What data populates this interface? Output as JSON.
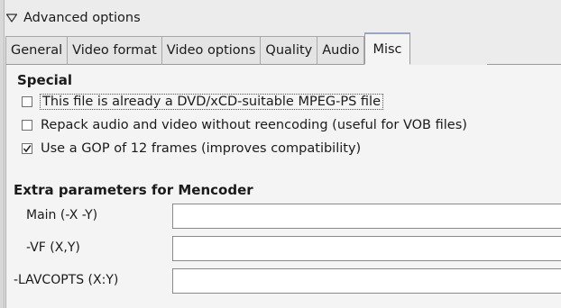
{
  "expander": {
    "label": "Advanced options",
    "expanded": true
  },
  "tabs": [
    {
      "label": "General",
      "active": false
    },
    {
      "label": "Video format",
      "active": false
    },
    {
      "label": "Video options",
      "active": false
    },
    {
      "label": "Quality",
      "active": false
    },
    {
      "label": "Audio",
      "active": false
    },
    {
      "label": "Misc",
      "active": true
    }
  ],
  "special": {
    "heading": "Special",
    "options": [
      {
        "label": "This file is already a DVD/xCD-suitable MPEG-PS file",
        "checked": false
      },
      {
        "label": "Repack audio and video without reencoding (useful for VOB files)",
        "checked": false
      },
      {
        "label": "Use a GOP of 12 frames (improves compatibility)",
        "checked": true
      }
    ]
  },
  "extra": {
    "heading": "Extra parameters for Mencoder",
    "fields": [
      {
        "label": "Main (-X -Y)",
        "value": ""
      },
      {
        "label": "-VF (X,Y)",
        "value": ""
      },
      {
        "label": "-LAVCOPTS (X:Y)",
        "value": ""
      }
    ]
  }
}
